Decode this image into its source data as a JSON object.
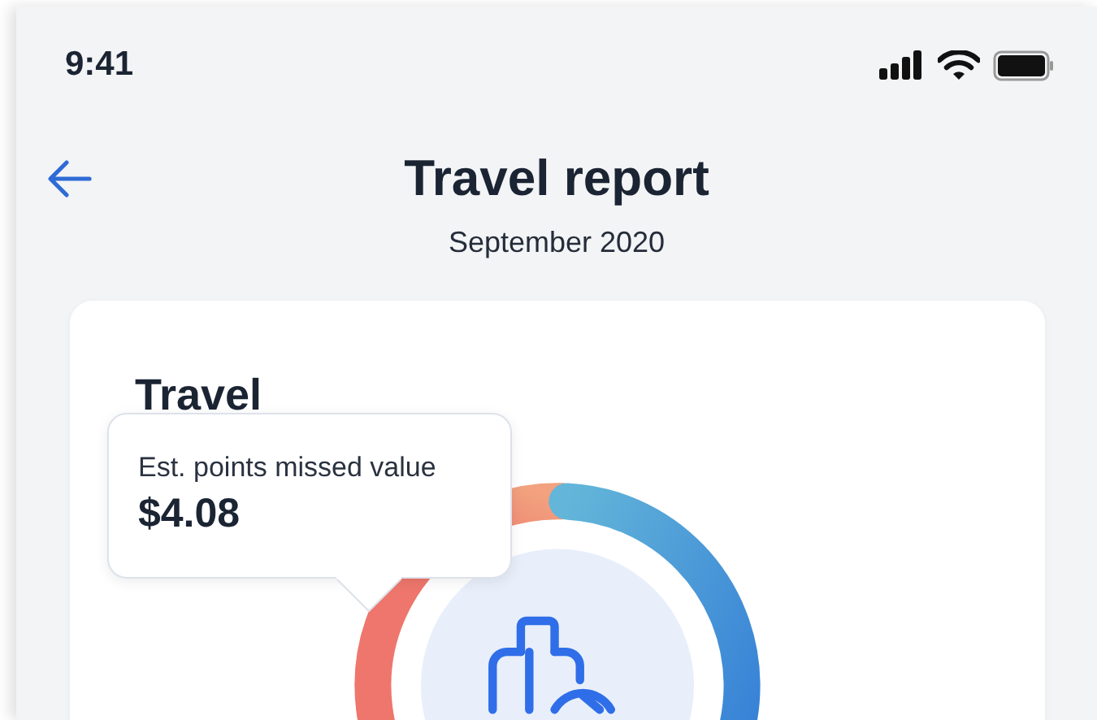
{
  "status_bar": {
    "time": "9:41"
  },
  "header": {
    "title": "Travel report",
    "subtitle": "September 2020"
  },
  "card": {
    "title": "Travel",
    "tooltip": {
      "label": "Est. points missed value",
      "value": "$4.08"
    }
  }
}
